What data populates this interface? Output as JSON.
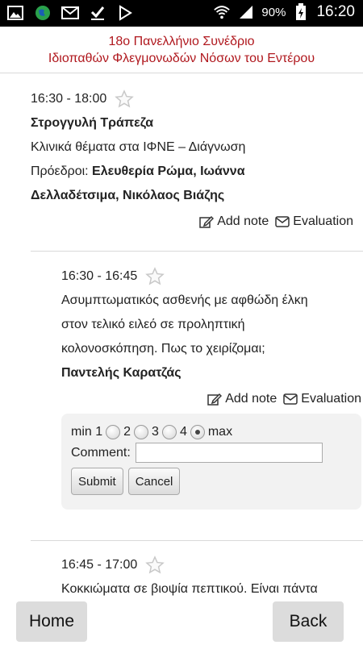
{
  "status": {
    "battery": "90%",
    "time": "16:20"
  },
  "header": {
    "line1": "18ο Πανελλήνιο Συνέδριο",
    "line2": "Ιδιοπαθών Φλεγμονωδών Νόσων του Εντέρου"
  },
  "session": {
    "time": "16:30  -  18:00",
    "type": "Στρογγυλή Τράπεζα",
    "title": "Κλινικά θέματα στα ΙΦΝΕ – Διάγνωση",
    "chairs_label": "Πρόεδροι: ",
    "chairs_line1": "Ελευθερία Ρώμα, Ιωάννα",
    "chairs_line2": "Δελλαδέτσιμα, Νικόλαος Βιάζης",
    "add_note": "Add note",
    "evaluation": "Evaluation"
  },
  "talk1": {
    "time": "16:30  -  16:45",
    "title_line1": "Ασυμπτωματικός ασθενής με αφθώδη έλκη",
    "title_line2": "στον τελικό ειλεό σε προληπτική",
    "title_line3": "κολονοσκόπηση. Πως το χειρίζομαι;",
    "speaker": "Παντελής Καρατζάς",
    "add_note": "Add note",
    "evaluation": "Evaluation"
  },
  "eval_form": {
    "min_label": "min 1",
    "opt2": "2",
    "opt3": "3",
    "opt4": "4",
    "max_label": "max",
    "selected": 5,
    "comment_label": "Comment:",
    "comment_value": "",
    "submit": "Submit",
    "cancel": "Cancel"
  },
  "talk2": {
    "time": "16:45  -  17:00",
    "title_line1": "Κοκκιώματα σε βιοψία πεπτικού. Είναι πάντα"
  },
  "footer": {
    "home": "Home",
    "back": "Back"
  }
}
